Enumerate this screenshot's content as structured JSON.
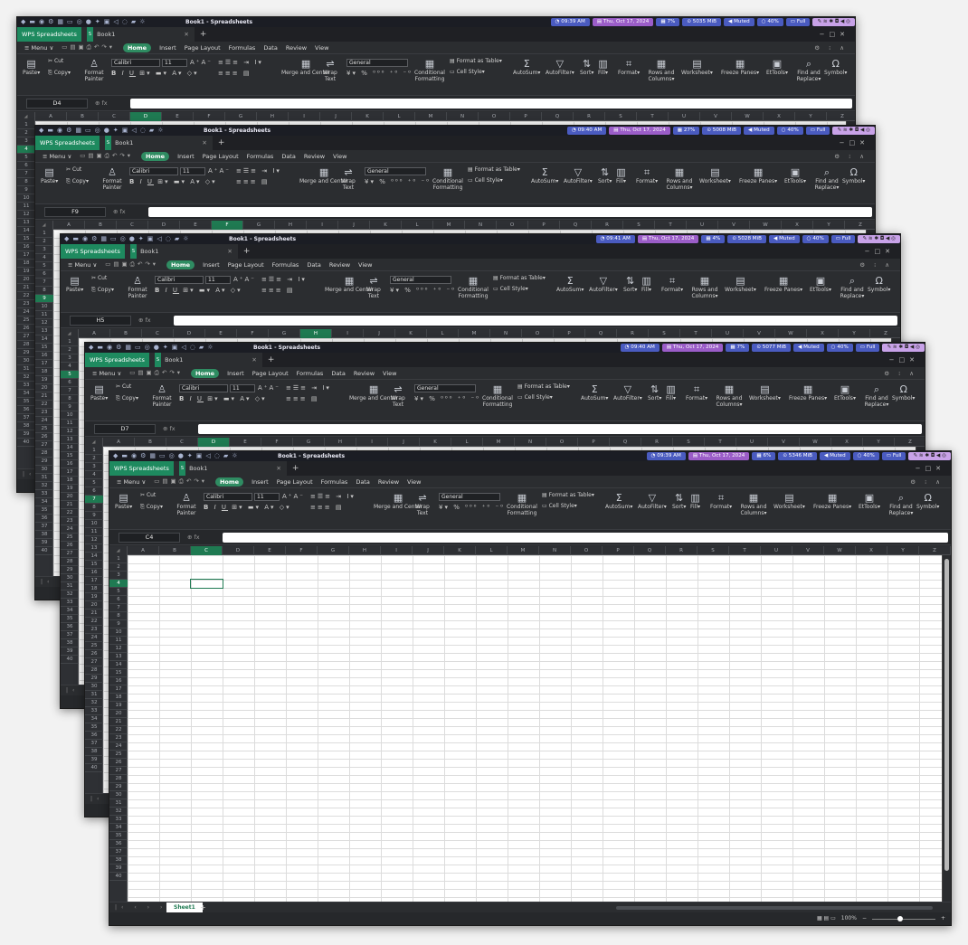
{
  "shots": [
    {
      "taskbar": {
        "time": "09:39 AM",
        "date": "Thu, Oct 17, 2024",
        "cpu": "7%",
        "mem": "5035 MiB",
        "volume": "Muted",
        "brightness": "40%",
        "battery": "Full",
        "title": "Book1 - Spreadsheets"
      },
      "cell_ref": "D4",
      "active_col": "D",
      "active_row": "4"
    },
    {
      "taskbar": {
        "time": "09:40 AM",
        "date": "Thu, Oct 17, 2024",
        "cpu": "27%",
        "mem": "5008 MiB",
        "volume": "Muted",
        "brightness": "40%",
        "battery": "Full",
        "title": "Book1 - Spreadsheets"
      },
      "cell_ref": "F9",
      "active_col": "F",
      "active_row": "9"
    },
    {
      "taskbar": {
        "time": "09:41 AM",
        "date": "Thu, Oct 17, 2024",
        "cpu": "4%",
        "mem": "5028 MiB",
        "volume": "Muted",
        "brightness": "40%",
        "battery": "Full",
        "title": "Book1 - Spreadsheets"
      },
      "cell_ref": "H5",
      "active_col": "H",
      "active_row": "5"
    },
    {
      "taskbar": {
        "time": "09:40 AM",
        "date": "Thu, Oct 17, 2024",
        "cpu": "7%",
        "mem": "5077 MiB",
        "volume": "Muted",
        "brightness": "40%",
        "battery": "Full",
        "title": "Book1 - Spreadsheets"
      },
      "cell_ref": "D7",
      "active_col": "D",
      "active_row": "7"
    },
    {
      "taskbar": {
        "time": "09:39 AM",
        "date": "Thu, Oct 17, 2024",
        "cpu": "6%",
        "mem": "5346 MiB",
        "volume": "Muted",
        "brightness": "40%",
        "battery": "Full",
        "title": "Book1 - Spreadsheets"
      },
      "cell_ref": "C4",
      "active_col": "C",
      "active_row": "4"
    }
  ],
  "app": {
    "name": "WPS Spreadsheets",
    "doc_title": "Book1"
  },
  "menu": {
    "menu": "Menu",
    "home": "Home",
    "insert": "Insert",
    "page_layout": "Page Layout",
    "formulas": "Formulas",
    "data": "Data",
    "review": "Review",
    "view": "View"
  },
  "ribbon": {
    "paste": "Paste",
    "cut": "Cut",
    "copy": "Copy",
    "format_painter": "Format Painter",
    "font_name": "Calibri",
    "font_size": "11",
    "merge_center": "Merge and Center",
    "wrap_text": "Wrap Text",
    "number_format": "General",
    "conditional_formatting": "Conditional Formatting",
    "format_as_table": "Format as Table",
    "cell_style": "Cell Style",
    "autosum": "AutoSum",
    "autofilter": "AutoFilter",
    "sort": "Sort",
    "fill": "Fill",
    "format": "Format",
    "rows_columns": "Rows and Columns",
    "worksheet": "Worksheet",
    "freeze_panes": "Freeze Panes",
    "ettools": "EtTools",
    "find_replace": "Find and Replace",
    "symbol": "Symbol"
  },
  "sheet": {
    "tab": "Sheet1",
    "zoom": "100%"
  },
  "columns": [
    "A",
    "B",
    "C",
    "D",
    "E",
    "F",
    "G",
    "H",
    "I",
    "J",
    "K",
    "L",
    "M",
    "N",
    "O",
    "P",
    "Q",
    "R",
    "S",
    "T",
    "U",
    "V",
    "W",
    "X",
    "Y",
    "Z"
  ],
  "rows": [
    "1",
    "2",
    "3",
    "4",
    "5",
    "6",
    "7",
    "8",
    "9",
    "10",
    "11",
    "12",
    "13",
    "14",
    "15",
    "16",
    "17",
    "18",
    "19",
    "20",
    "21",
    "22",
    "23",
    "24",
    "25",
    "26",
    "27",
    "28",
    "29",
    "30",
    "31",
    "32",
    "33",
    "34",
    "35",
    "36",
    "37",
    "38",
    "39",
    "40"
  ],
  "colors": {
    "accent": "#1f7a52",
    "home_pill": "#2f8c62",
    "app_tab": "#1e8a5f",
    "bar_blue": "#4a5bc0",
    "bar_mauve": "#9b5dc8"
  }
}
